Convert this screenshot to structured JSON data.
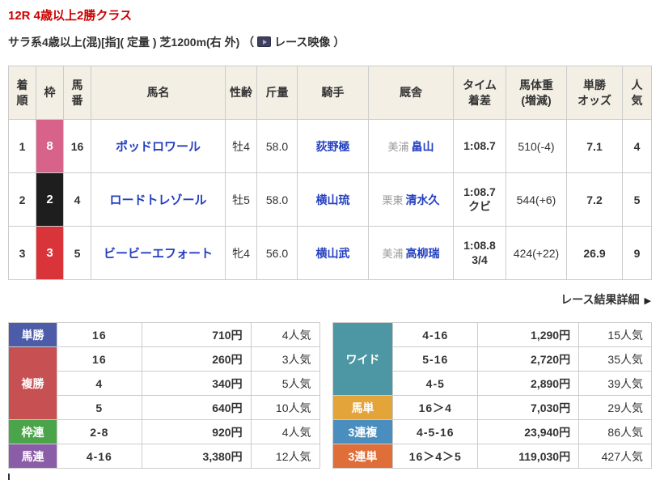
{
  "page": {
    "title": "12R 4歳以上2勝クラス",
    "title_color": "#cc0000",
    "conditions": "サラ系4歳以上(混)[指]( 定量 ) 芝1200m(右 外) （",
    "video_label": "レース映像",
    "conditions_close": "）",
    "details_label": "レース結果詳細",
    "details_arrow": "▶"
  },
  "results": {
    "headers": {
      "position": "着\n順",
      "frame": "枠",
      "horse_number": "馬\n番",
      "horse_name": "馬名",
      "sex_age": "性齢",
      "weight": "斤量",
      "jockey": "騎手",
      "stable": "厩舎",
      "time_margin": "タイム\n着差",
      "horse_weight": "馬体重\n(増減)",
      "odds": "単勝\nオッズ",
      "popularity": "人\n気"
    },
    "rows": [
      {
        "position": "1",
        "frame": "8",
        "frame_bg": "#d7638a",
        "frame_fg": "#ffffff",
        "horse_number": "16",
        "horse_name": "ポッドロワール",
        "sex_age": "牡4",
        "weight": "58.0",
        "jockey": "荻野極",
        "stable_region": "美浦",
        "trainer": "畠山",
        "time": "1:08.7",
        "margin": "",
        "horse_weight": "510(-4)",
        "odds": "7.1",
        "popularity": "4"
      },
      {
        "position": "2",
        "frame": "2",
        "frame_bg": "#1e1e1e",
        "frame_fg": "#ffffff",
        "horse_number": "4",
        "horse_name": "ロードトレゾール",
        "sex_age": "牡5",
        "weight": "58.0",
        "jockey": "横山琉",
        "stable_region": "栗東",
        "trainer": "清水久",
        "time": "1:08.7",
        "margin": "クビ",
        "horse_weight": "544(+6)",
        "odds": "7.2",
        "popularity": "5"
      },
      {
        "position": "3",
        "frame": "3",
        "frame_bg": "#d93439",
        "frame_fg": "#ffffff",
        "horse_number": "5",
        "horse_name": "ビービーエフォート",
        "sex_age": "牝4",
        "weight": "56.0",
        "jockey": "横山武",
        "stable_region": "美浦",
        "trainer": "高柳瑞",
        "time": "1:08.8",
        "margin": "3/4",
        "horse_weight": "424(+22)",
        "odds": "26.9",
        "popularity": "9"
      }
    ]
  },
  "payouts_left": {
    "groups": [
      {
        "label": "単勝",
        "color": "#4c5ca8",
        "rows": [
          {
            "combo": "16",
            "amount": "710円",
            "pop": "4人気"
          }
        ]
      },
      {
        "label": "複勝",
        "color": "#c65052",
        "rows": [
          {
            "combo": "16",
            "amount": "260円",
            "pop": "3人気"
          },
          {
            "combo": "4",
            "amount": "340円",
            "pop": "5人気"
          },
          {
            "combo": "5",
            "amount": "640円",
            "pop": "10人気"
          }
        ]
      },
      {
        "label": "枠連",
        "color": "#4aa54a",
        "rows": [
          {
            "combo": "2-8",
            "amount": "920円",
            "pop": "4人気"
          }
        ]
      },
      {
        "label": "馬連",
        "color": "#8b5ca7",
        "rows": [
          {
            "combo": "4-16",
            "amount": "3,380円",
            "pop": "12人気"
          }
        ]
      }
    ]
  },
  "payouts_right": {
    "groups": [
      {
        "label": "ワイド",
        "color": "#4d96a3",
        "rows": [
          {
            "combo": "4-16",
            "amount": "1,290円",
            "pop": "15人気"
          },
          {
            "combo": "5-16",
            "amount": "2,720円",
            "pop": "35人気"
          },
          {
            "combo": "4-5",
            "amount": "2,890円",
            "pop": "39人気"
          }
        ]
      },
      {
        "label": "馬単",
        "color": "#e3a43a",
        "rows": [
          {
            "combo": "16＞4",
            "amount": "7,030円",
            "pop": "29人気"
          }
        ]
      },
      {
        "label": "3連複",
        "color": "#4a8ec0",
        "rows": [
          {
            "combo": "4-5-16",
            "amount": "23,940円",
            "pop": "86人気"
          }
        ]
      },
      {
        "label": "3連単",
        "color": "#df6e38",
        "rows": [
          {
            "combo": "16＞4＞5",
            "amount": "119,030円",
            "pop": "427人気"
          }
        ]
      }
    ]
  }
}
